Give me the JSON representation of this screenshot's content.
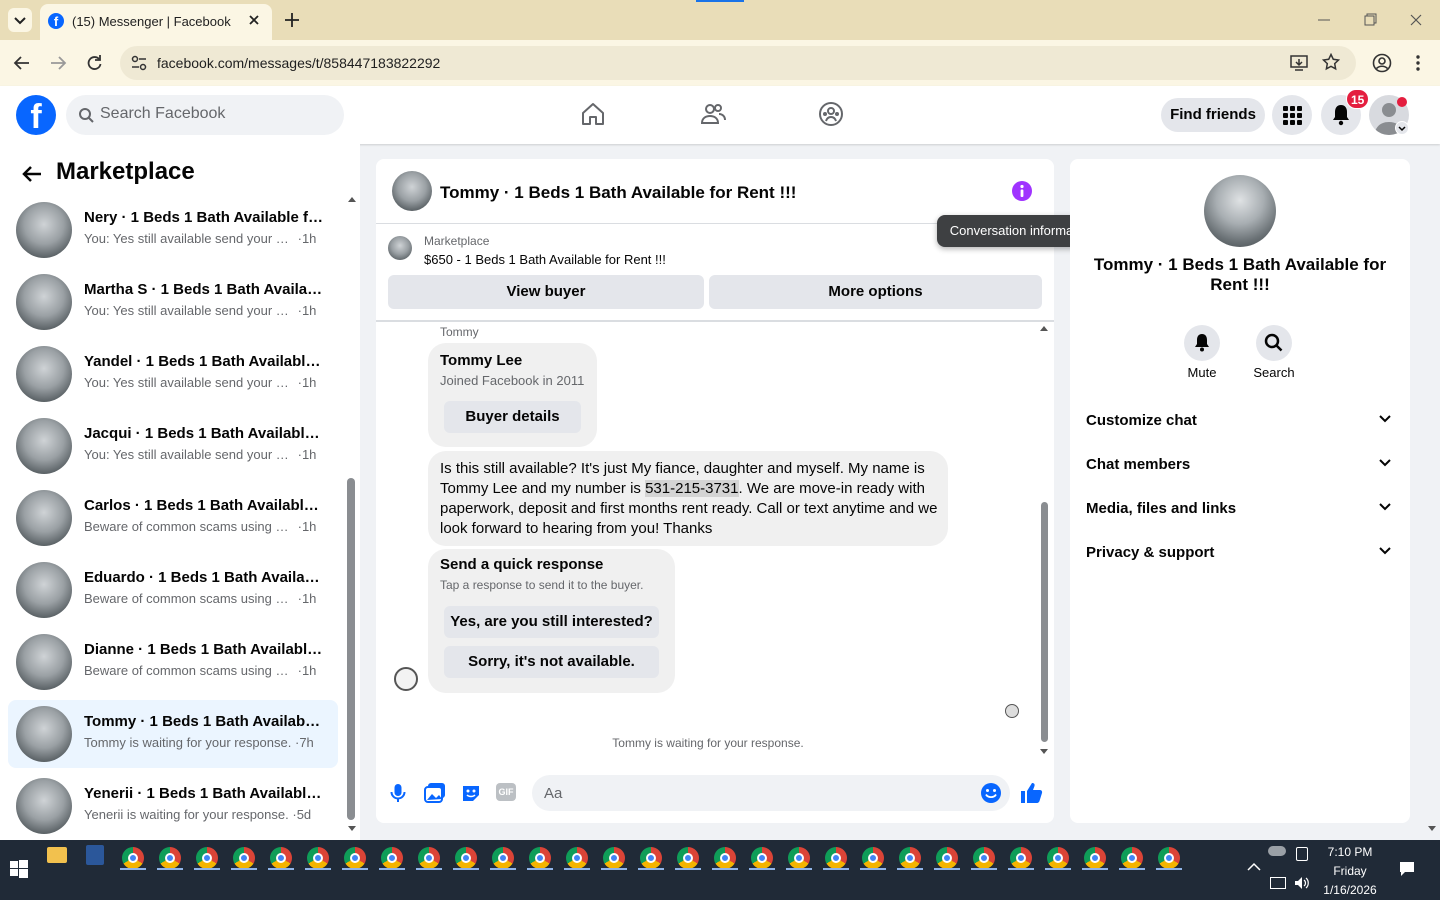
{
  "browser": {
    "tab_title": "(15) Messenger | Facebook",
    "url": "facebook.com/messages/t/858447183822292"
  },
  "header": {
    "search_placeholder": "Search Facebook",
    "find_friends": "Find friends",
    "notification_count": "15"
  },
  "sidebar": {
    "title": "Marketplace",
    "conversations": [
      {
        "title": "Nery · 1 Beds 1 Bath Available fo...",
        "message": "You: Yes still available send your co...",
        "time": "1h",
        "selected": false
      },
      {
        "title": "Martha S · 1 Beds 1 Bath Availabl...",
        "message": "You: Yes still available send your co...",
        "time": "1h",
        "selected": false
      },
      {
        "title": "Yandel · 1 Beds 1 Bath Available f...",
        "message": "You: Yes still available send your co...",
        "time": "1h",
        "selected": false
      },
      {
        "title": "Jacqui · 1 Beds 1 Bath Available f...",
        "message": "You: Yes still available send your co...",
        "time": "1h",
        "selected": false
      },
      {
        "title": "Carlos · 1 Beds 1 Bath Available f...",
        "message": "Beware of common scams using pa...",
        "time": "1h",
        "selected": false
      },
      {
        "title": "Eduardo · 1 Beds 1 Bath Availabl...",
        "message": "Beware of common scams using pa...",
        "time": "1h",
        "selected": false
      },
      {
        "title": "Dianne · 1 Beds 1 Bath Available ...",
        "message": "Beware of common scams using pa...",
        "time": "1h",
        "selected": false
      },
      {
        "title": "Tommy · 1 Beds 1 Bath Available ...",
        "message": "Tommy is waiting for your response.",
        "time": "7h",
        "selected": true
      },
      {
        "title": "Yenerii · 1 Beds 1 Bath Available f...",
        "message": "Yenerii is waiting for your response.",
        "time": "5d",
        "selected": false
      }
    ]
  },
  "chat": {
    "title": "Tommy · 1 Beds 1 Bath Available for Rent !!!",
    "tooltip": "Conversation information",
    "listing_source": "Marketplace",
    "listing_line": "$650 - 1 Beds 1 Bath Available for Rent !!!",
    "view_buyer": "View buyer",
    "more_options": "More options",
    "sender_label": "Tommy",
    "profile_name": "Tommy Lee",
    "profile_joined": "Joined Facebook in 2011",
    "buyer_details": "Buyer details",
    "message_before": "Is this still available? It's just My fiance, daughter and myself. My name is Tommy Lee and my number is ",
    "message_phone": "531-215-3731",
    "message_after": ". We are move-in ready with paperwork, deposit and first months rent ready. Call or text anytime and we look forward to hearing from you! Thanks",
    "quick_title": "Send a quick response",
    "quick_sub": "Tap a response to send it to the buyer.",
    "quick_1": "Yes, are you still interested?",
    "quick_2": "Sorry, it's not available.",
    "waiting": "Tommy is waiting for your response.",
    "composer_placeholder": "Aa"
  },
  "info_panel": {
    "title": "Tommy · 1 Beds 1 Bath Available for Rent !!!",
    "mute": "Mute",
    "search": "Search",
    "sections": [
      "Customize chat",
      "Chat members",
      "Media, files and links",
      "Privacy & support"
    ]
  },
  "taskbar": {
    "time": "7:10 PM",
    "day": "Friday",
    "date": "1/16/2026"
  },
  "colors": {
    "fb_blue": "#0866ff",
    "messenger_purple": "#a033ff",
    "badge_red": "#e41e3f",
    "selected_bg": "#ebf5ff"
  }
}
